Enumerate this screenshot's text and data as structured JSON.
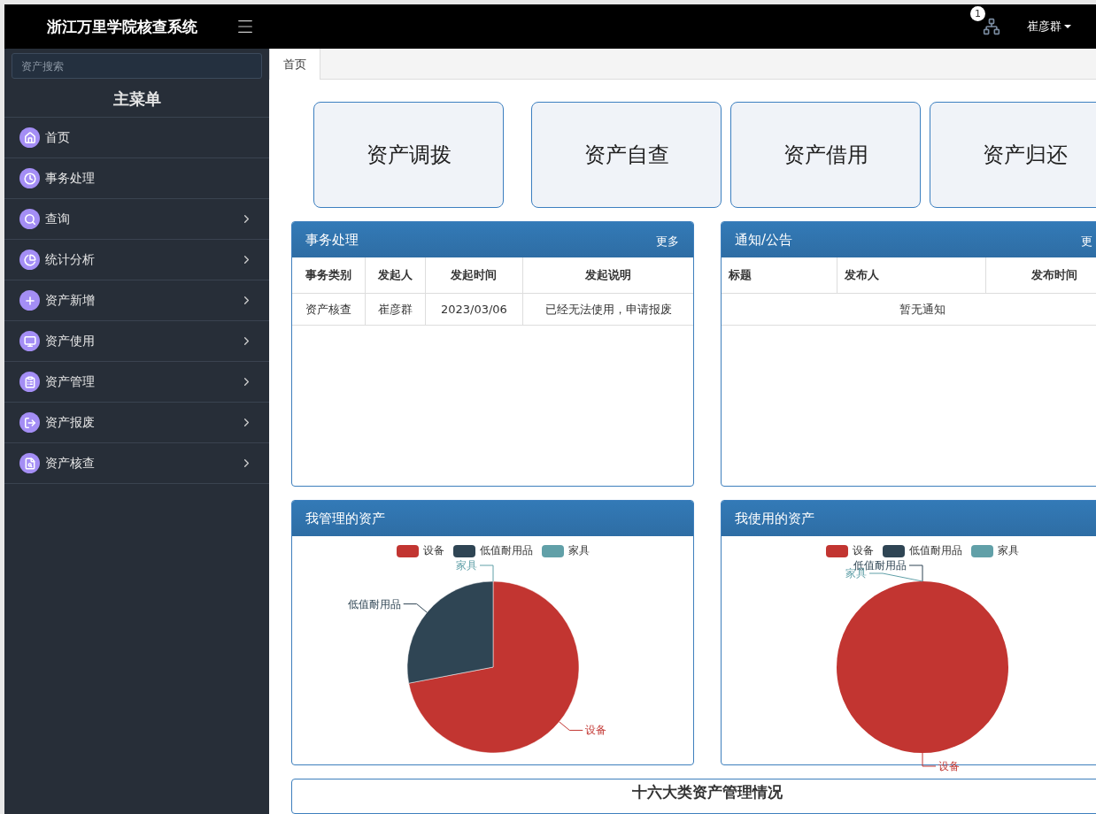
{
  "header": {
    "title": "浙江万里学院核查系统",
    "notification_count": "1",
    "user": "崔彦群"
  },
  "sidebar": {
    "search": {
      "placeholder": "资产搜索"
    },
    "menu_title": "主菜单",
    "items": [
      {
        "label": "首页",
        "kind": "link"
      },
      {
        "label": "事务处理",
        "kind": "link"
      },
      {
        "label": "查询",
        "kind": "submenu"
      },
      {
        "label": "统计分析",
        "kind": "submenu"
      },
      {
        "label": "资产新增",
        "kind": "submenu"
      },
      {
        "label": "资产使用",
        "kind": "submenu"
      },
      {
        "label": "资产管理",
        "kind": "submenu"
      },
      {
        "label": "资产报废",
        "kind": "submenu"
      },
      {
        "label": "资产核查",
        "kind": "submenu"
      }
    ]
  },
  "tabs": [
    {
      "label": "首页",
      "selected": true
    }
  ],
  "shortcuts": [
    "资产调拨",
    "资产自查",
    "资产借用",
    "资产归还"
  ],
  "affairs": {
    "title": "事务处理",
    "more": "更多",
    "columns": [
      "事务类别",
      "发起人",
      "发起时间",
      "发起说明"
    ],
    "rows": [
      [
        "资产核查",
        "崔彦群",
        "2023/03/06",
        "已经无法使用，申请报废"
      ]
    ]
  },
  "notices": {
    "title": "通知/公告",
    "more": "更",
    "columns": [
      "标题",
      "发布人",
      "发布时间"
    ],
    "empty": "暂无通知"
  },
  "charts": [
    {
      "title": "我管理的资产",
      "chart_data": {
        "type": "pie",
        "categories": [
          "设备",
          "低值耐用品",
          "家具"
        ],
        "values": [
          72,
          28,
          0
        ],
        "colors": [
          "#c23531",
          "#2f4554",
          "#61a0a8"
        ]
      }
    },
    {
      "title": "我使用的资产",
      "chart_data": {
        "type": "pie",
        "categories": [
          "设备",
          "低值耐用品",
          "家具"
        ],
        "values": [
          100,
          0,
          0
        ],
        "colors": [
          "#c23531",
          "#2f4554",
          "#61a0a8"
        ]
      }
    }
  ],
  "bottom_panel": {
    "title": "十六大类资产管理情况"
  }
}
